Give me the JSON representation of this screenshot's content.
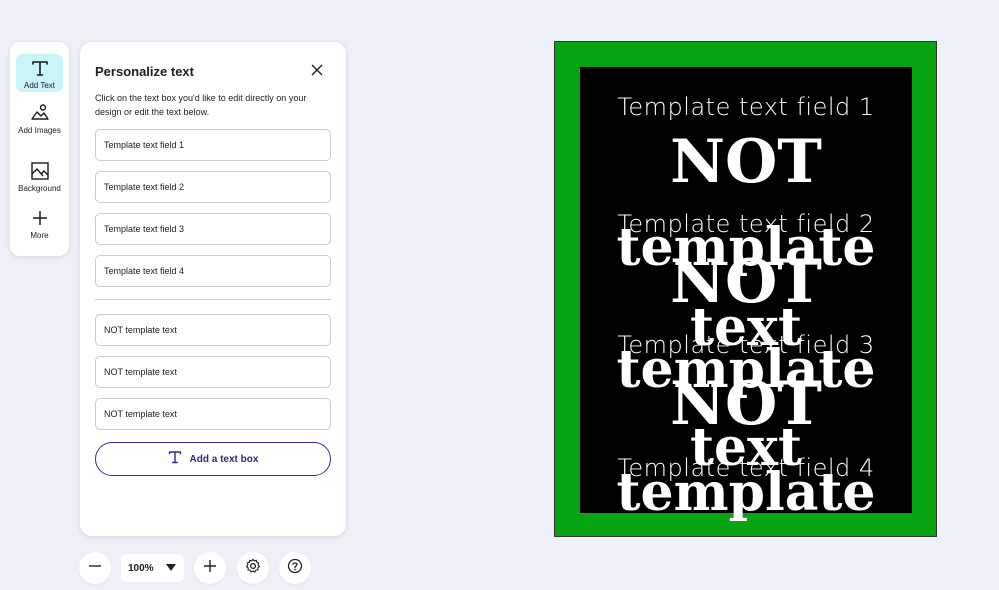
{
  "rail": {
    "items": [
      {
        "label": "Add Text",
        "icon": "text-icon"
      },
      {
        "label": "Add Images",
        "icon": "image-add-icon"
      },
      {
        "label": "Background",
        "icon": "background-icon"
      },
      {
        "label": "More",
        "icon": "plus-icon"
      }
    ]
  },
  "panel": {
    "title": "Personalize text",
    "instructions": "Click on the text box you'd like to edit directly on your design or edit the text below.",
    "template_fields": [
      "Template text field 1",
      "Template text field 2",
      "Template text field 3",
      "Template text field 4"
    ],
    "other_fields": [
      "NOT template text",
      "NOT template text",
      "NOT template text"
    ],
    "add_button_label": "Add a text box"
  },
  "zoom": {
    "value": "100%"
  },
  "design": {
    "border_color": "#06a312",
    "background_color": "#000000",
    "text_color": "#ffffff",
    "template_texts": [
      "Template text field 1",
      "Template text field 2",
      "Template text field 3",
      "Template text field 4"
    ],
    "word_not": "NOT",
    "word_template": "template",
    "word_text": "text"
  },
  "colors": {
    "accent": "#c9f4f8",
    "button_outline": "#2f2f8f"
  }
}
